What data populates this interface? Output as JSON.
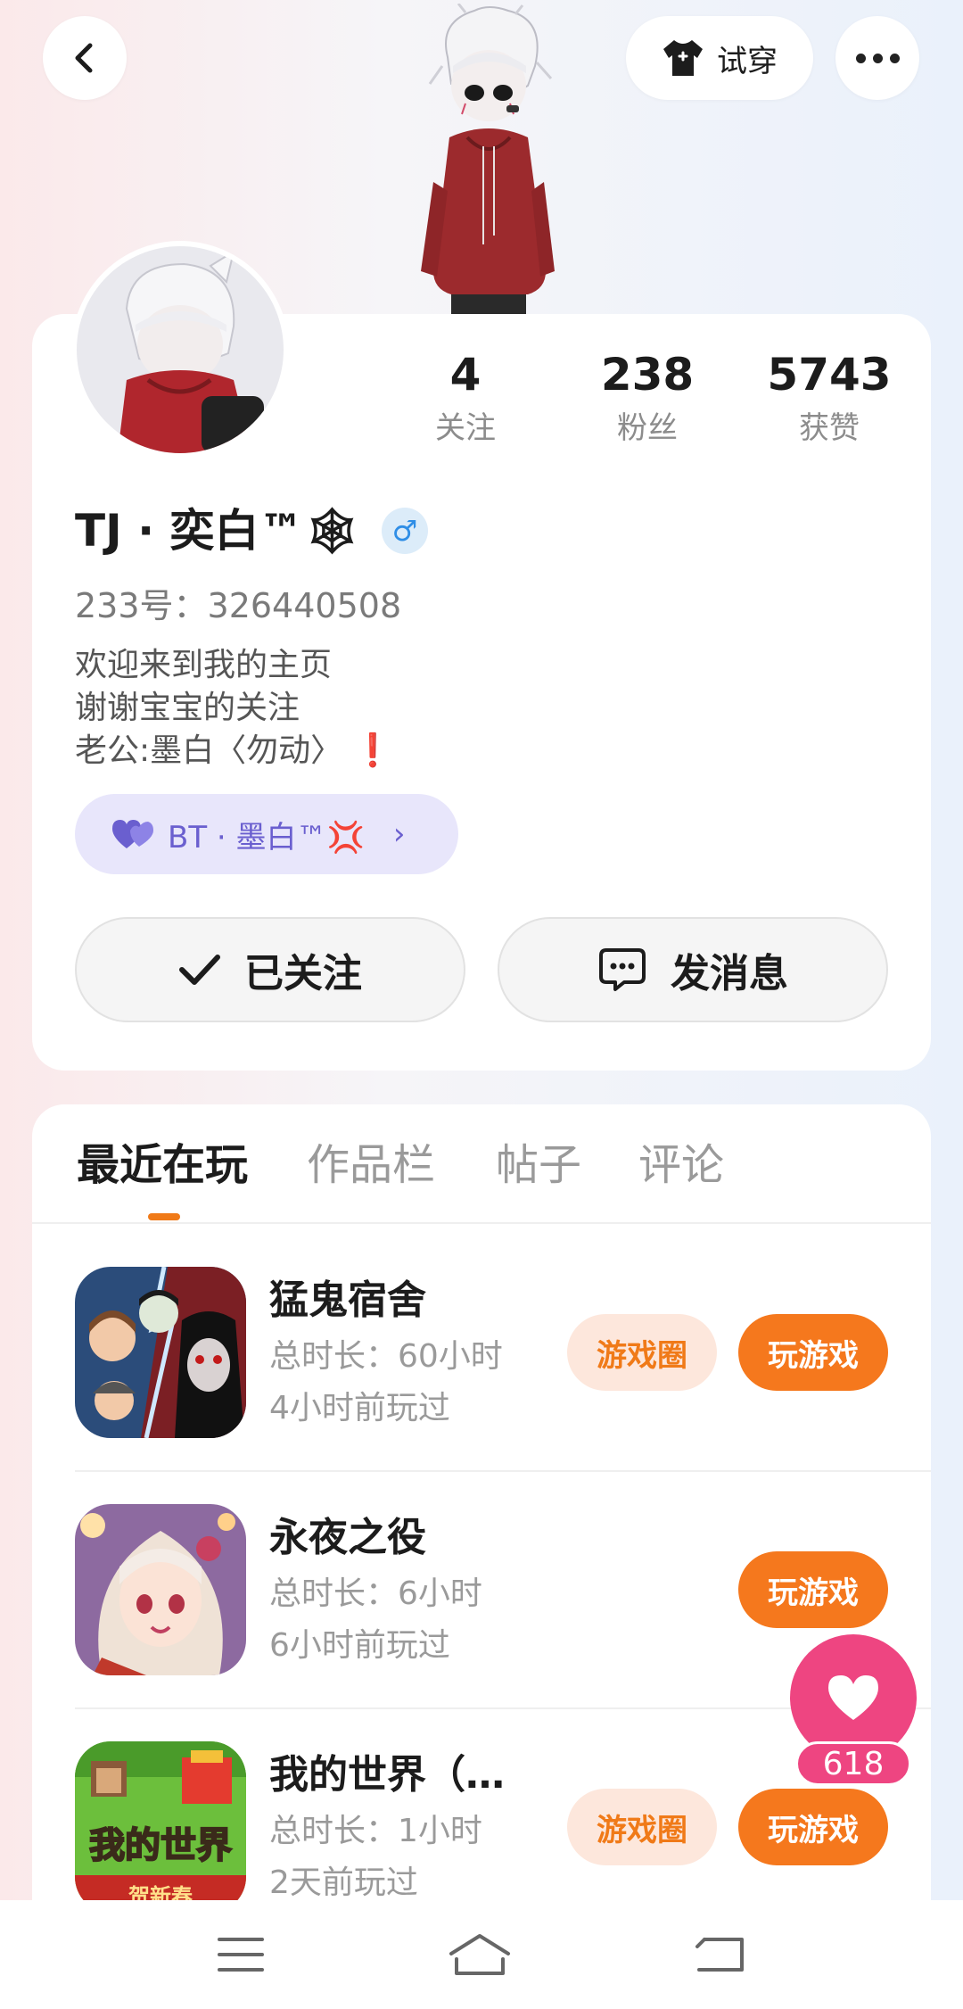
{
  "header": {
    "tryon_label": "试穿"
  },
  "stats": [
    {
      "num": "4",
      "label": "关注"
    },
    {
      "num": "238",
      "label": "粉丝"
    },
    {
      "num": "5743",
      "label": "获赞"
    }
  ],
  "profile": {
    "name": "TJ · 奕白™🕸",
    "gender": "♂",
    "uid": "233号：326440508",
    "bio": [
      "欢迎来到我的主页",
      "谢谢宝宝的关注",
      "老公:墨白〈勿动〉"
    ],
    "bio_mark": "❗",
    "bond_label": "BT · 墨白™💢"
  },
  "actions": {
    "follow_label": "已关注",
    "message_label": "发消息"
  },
  "tabs": [
    "最近在玩",
    "作品栏",
    "帖子",
    "评论"
  ],
  "games": [
    {
      "name": "猛鬼宿舍",
      "duration": "总时长：60小时",
      "last": "4小时前玩过",
      "circle": "游戏圈",
      "play": "玩游戏"
    },
    {
      "name": "永夜之役",
      "duration": "总时长：6小时",
      "last": "6小时前玩过",
      "play": "玩游戏"
    },
    {
      "name": "我的世界（…",
      "duration": "总时长：1小时",
      "last": "2天前玩过",
      "circle": "游戏圈",
      "play": "玩游戏",
      "icon_text": "我的世界",
      "icon_sub": "贺新春"
    }
  ],
  "like": {
    "count": "618"
  },
  "colors": {
    "accent": "#f5781d",
    "like": "#ee4581",
    "bond": "#6a5fcf"
  }
}
